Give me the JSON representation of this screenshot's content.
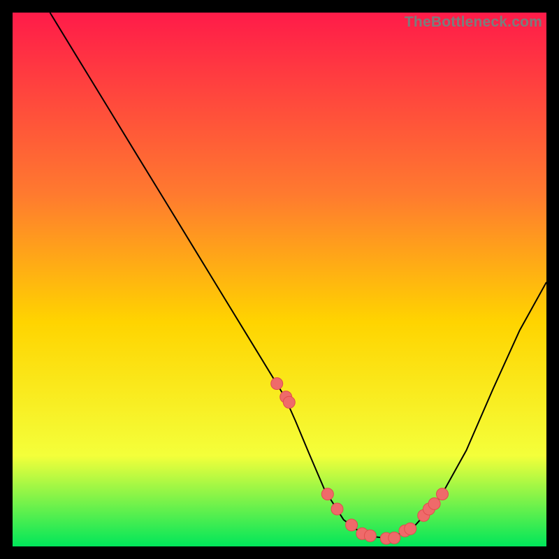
{
  "watermark": "TheBottleneck.com",
  "colors": {
    "gradient_top": "#ff1b49",
    "gradient_upper_mid": "#ff7a2f",
    "gradient_mid": "#ffd400",
    "gradient_lower_mid": "#f4ff3a",
    "gradient_bottom": "#00e65a",
    "curve": "#000000",
    "marker": "#ef6a6a",
    "marker_stroke": "#e14d4d",
    "frame_bg": "#000000"
  },
  "chart_data": {
    "type": "line",
    "title": "",
    "xlabel": "",
    "ylabel": "",
    "xlim": [
      0,
      100
    ],
    "ylim": [
      0,
      100
    ],
    "grid": false,
    "legend": false,
    "series": [
      {
        "name": "curve",
        "x": [
          7.0,
          12.5,
          18.0,
          23.5,
          29.0,
          34.5,
          40.0,
          45.5,
          51.0,
          53.0,
          55.5,
          58.5,
          62.0,
          66.0,
          70.5,
          75.0,
          80.0,
          85.0,
          90.0,
          95.0,
          100.0
        ],
        "y": [
          100.0,
          91.0,
          82.0,
          73.0,
          64.0,
          55.0,
          46.0,
          37.0,
          28.0,
          23.5,
          17.5,
          10.5,
          5.0,
          2.0,
          1.5,
          3.5,
          9.0,
          18.0,
          29.5,
          40.5,
          49.5
        ]
      }
    ],
    "markers": {
      "name": "highlight-cluster",
      "x": [
        49.5,
        51.2,
        51.8,
        59.0,
        60.8,
        63.5,
        65.5,
        67.0,
        70.0,
        71.5,
        73.5,
        74.5,
        77.0,
        78.0,
        79.0,
        80.5
      ],
      "y": [
        30.5,
        28.0,
        27.0,
        9.8,
        7.0,
        4.0,
        2.4,
        2.0,
        1.5,
        1.6,
        2.9,
        3.3,
        5.8,
        7.0,
        8.0,
        9.8
      ]
    }
  }
}
